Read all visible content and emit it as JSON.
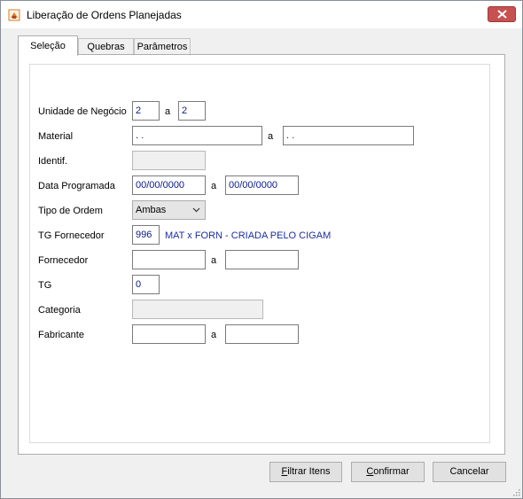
{
  "window": {
    "title": "Liberação de Ordens Planejadas",
    "app_icon": "app-icon",
    "close_icon": "close-icon"
  },
  "tabs": [
    {
      "label": "Seleção",
      "active": true
    },
    {
      "label": "Quebras",
      "active": false
    },
    {
      "label": "Parâmetros",
      "active": false
    }
  ],
  "form": {
    "unidade_label": "Unidade de Negócio",
    "unidade_from": "2",
    "unidade_sep": "a",
    "unidade_to": "2",
    "material_label": "Material",
    "material_from": " .  .",
    "material_sep": "a",
    "material_to": " .  .",
    "identif_label": "Identif.",
    "identif_value": "",
    "data_label": "Data Programada",
    "data_from": "00/00/0000",
    "data_sep": "a",
    "data_to": "00/00/0000",
    "tipo_label": "Tipo de Ordem",
    "tipo_value": "Ambas",
    "tg_fornecedor_label": "TG Fornecedor",
    "tg_fornecedor_value": "996",
    "tg_fornecedor_desc": "MAT x FORN - CRIADA PELO CIGAM",
    "fornecedor_label": "Fornecedor",
    "fornecedor_from": "",
    "fornecedor_sep": "a",
    "fornecedor_to": "",
    "tg_label": "TG",
    "tg_value": "0",
    "categoria_label": "Categoria",
    "categoria_value": "",
    "fabricante_label": "Fabricante",
    "fabricante_from": "",
    "fabricante_sep": "a",
    "fabricante_to": ""
  },
  "buttons": {
    "filtrar_first": "F",
    "filtrar_rest": "iltrar Itens",
    "confirmar_first": "C",
    "confirmar_rest": "onfirmar",
    "cancelar": "Cancelar"
  },
  "colors": {
    "value_text": "#0a1a8a",
    "description_text": "#1a2fa0",
    "close_button": "#c75050"
  }
}
